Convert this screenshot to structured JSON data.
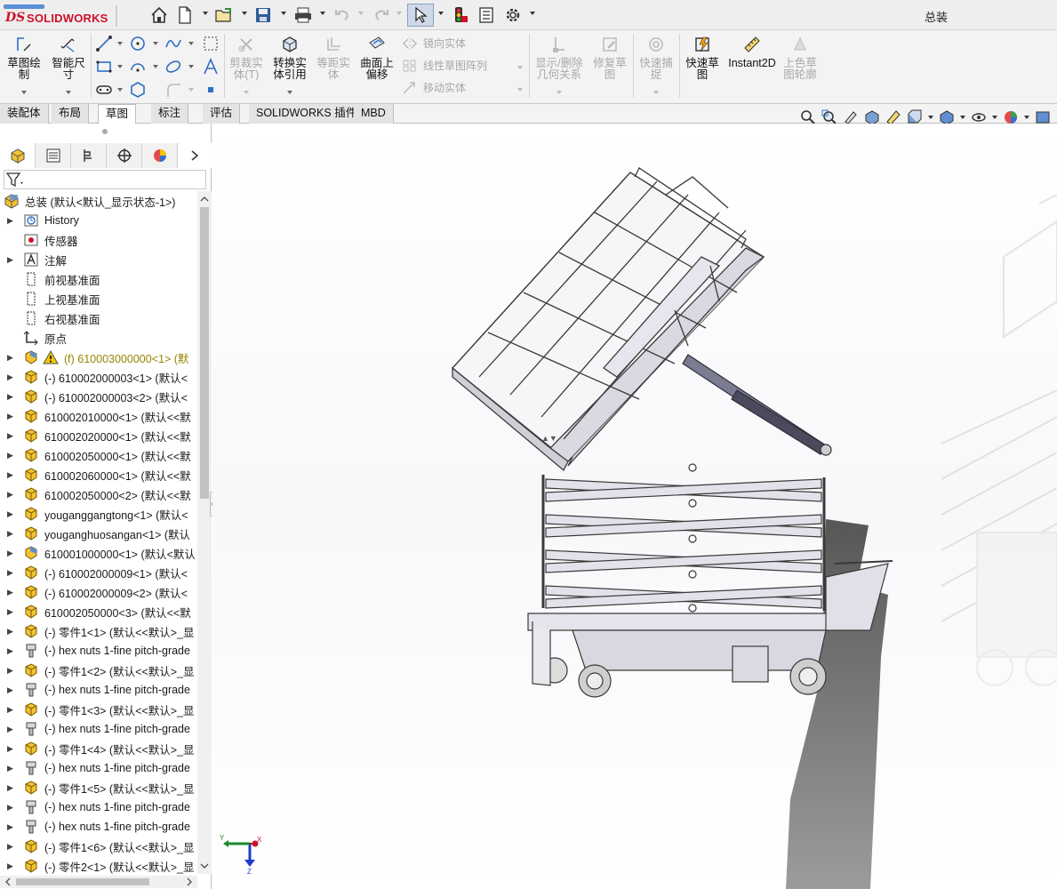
{
  "app": {
    "logo_ds": "DS",
    "logo_text": "SOLIDWORKS",
    "document_title": "总装"
  },
  "ribbon": {
    "sketch": "草图绘\n制",
    "smart_dimension": "智能尺\n寸",
    "trim_entities": "剪裁实\n体(T)",
    "convert_entities": "转换实\n体引用",
    "offset_entities": "等距实\n体",
    "offset_on_surface": "曲面上\n偏移",
    "mirror_entities": "镜向实体",
    "linear_pattern": "线性草图阵列",
    "move_entities": "移动实体",
    "display_delete_relations": "显示/删除\n几何关系",
    "repair_sketch": "修复草\n图",
    "quick_snaps": "快速捕\n捉",
    "rapid_sketch": "快速草\n图",
    "instant2d": "Instant2D",
    "shaded_contours": "上色草\n图轮廓"
  },
  "tabs": [
    {
      "label": "装配体",
      "active": false
    },
    {
      "label": "布局",
      "active": false
    },
    {
      "label": "草图",
      "active": true
    },
    {
      "label": "标注",
      "active": false
    },
    {
      "label": "评估",
      "active": false
    },
    {
      "label": "SOLIDWORKS 插件",
      "active": false
    },
    {
      "label": "MBD",
      "active": false
    }
  ],
  "tree": {
    "root": "总装  (默认<默认_显示状态-1>)",
    "items": [
      {
        "label": "History",
        "icon": "history-icon",
        "expand": true
      },
      {
        "label": "传感器",
        "icon": "sensor-icon",
        "expand": false
      },
      {
        "label": "注解",
        "icon": "annotation-icon",
        "expand": true
      },
      {
        "label": "前视基准面",
        "icon": "plane-icon",
        "expand": false
      },
      {
        "label": "上视基准面",
        "icon": "plane-icon",
        "expand": false
      },
      {
        "label": "右视基准面",
        "icon": "plane-icon",
        "expand": false
      },
      {
        "label": "原点",
        "icon": "origin-icon",
        "expand": false
      },
      {
        "label": "(f) 610003000000<1> (默",
        "icon": "assembly-warning-icon",
        "expand": true,
        "warn": true
      },
      {
        "label": "(-) 610002000003<1> (默认<",
        "icon": "part-icon",
        "expand": true
      },
      {
        "label": "(-) 610002000003<2> (默认<",
        "icon": "part-icon",
        "expand": true
      },
      {
        "label": "610002010000<1> (默认<<默",
        "icon": "part-icon",
        "expand": true
      },
      {
        "label": "610002020000<1> (默认<<默",
        "icon": "part-icon",
        "expand": true
      },
      {
        "label": "610002050000<1> (默认<<默",
        "icon": "part-icon",
        "expand": true
      },
      {
        "label": "610002060000<1> (默认<<默",
        "icon": "part-icon",
        "expand": true
      },
      {
        "label": "610002050000<2> (默认<<默",
        "icon": "part-icon",
        "expand": true
      },
      {
        "label": "youganggangtong<1> (默认<",
        "icon": "part-icon",
        "expand": true
      },
      {
        "label": "youganghuosangan<1> (默认",
        "icon": "part-icon",
        "expand": true
      },
      {
        "label": "610001000000<1> (默认<默认",
        "icon": "assembly-icon",
        "expand": true
      },
      {
        "label": "(-) 610002000009<1> (默认<",
        "icon": "part-icon",
        "expand": true
      },
      {
        "label": "(-) 610002000009<2> (默认<",
        "icon": "part-icon",
        "expand": true
      },
      {
        "label": "610002050000<3> (默认<<默",
        "icon": "part-icon",
        "expand": true
      },
      {
        "label": "(-) 零件1<1> (默认<<默认>_显",
        "icon": "part-icon",
        "expand": true
      },
      {
        "label": "(-) hex nuts 1-fine pitch-grade",
        "icon": "nut-icon",
        "expand": true
      },
      {
        "label": "(-) 零件1<2> (默认<<默认>_显",
        "icon": "part-icon",
        "expand": true
      },
      {
        "label": "(-) hex nuts 1-fine pitch-grade",
        "icon": "nut-icon",
        "expand": true
      },
      {
        "label": "(-) 零件1<3> (默认<<默认>_显",
        "icon": "part-icon",
        "expand": true
      },
      {
        "label": "(-) hex nuts 1-fine pitch-grade",
        "icon": "nut-icon",
        "expand": true
      },
      {
        "label": "(-) 零件1<4> (默认<<默认>_显",
        "icon": "part-icon",
        "expand": true
      },
      {
        "label": "(-) hex nuts 1-fine pitch-grade",
        "icon": "nut-icon",
        "expand": true
      },
      {
        "label": "(-) 零件1<5> (默认<<默认>_显",
        "icon": "part-icon",
        "expand": true
      },
      {
        "label": "(-) hex nuts 1-fine pitch-grade",
        "icon": "nut-icon",
        "expand": true
      },
      {
        "label": "(-) hex nuts 1-fine pitch-grade",
        "icon": "nut-icon",
        "expand": true
      },
      {
        "label": "(-) 零件1<6> (默认<<默认>_显",
        "icon": "part-icon",
        "expand": true
      },
      {
        "label": "(-) 零件2<1> (默认<<默认>_显",
        "icon": "part-icon",
        "expand": true
      }
    ]
  },
  "triad": {
    "x": "X",
    "y": "Y",
    "z": "Z"
  },
  "colors": {
    "brand_red": "#d0102a",
    "part_yellow": "#f1c232",
    "warning_yellow": "#9a8400",
    "frame_gray": "#cfcfcf"
  }
}
